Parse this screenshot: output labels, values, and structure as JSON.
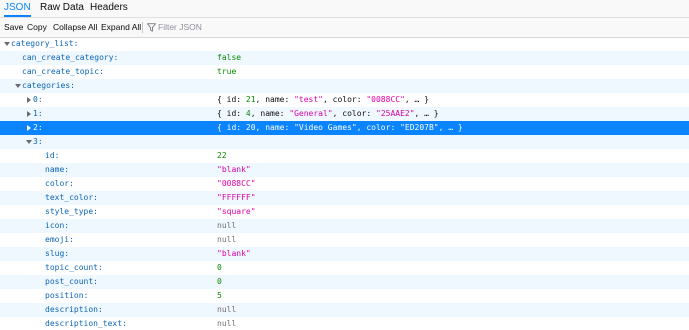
{
  "tabs": [
    {
      "label": "JSON",
      "selected": true
    },
    {
      "label": "Raw Data",
      "selected": false
    },
    {
      "label": "Headers",
      "selected": false
    }
  ],
  "toolbar": {
    "save_label": "Save",
    "copy_label": "Copy",
    "collapse_label": "Collapse All",
    "expand_label": "Expand All",
    "filter_placeholder": "Filter JSON",
    "filter_icon": "filter-icon"
  },
  "tree": {
    "root_key": "category_list:",
    "can_create_category": {
      "key": "can_create_category:",
      "value": "false"
    },
    "can_create_topic": {
      "key": "can_create_topic:",
      "value": "true"
    },
    "categories_key": "categories:",
    "cat0": {
      "key": "0:",
      "open": "{ ",
      "id_k": "id: ",
      "id_v": "21",
      "sep1": ", ",
      "name_k": "name: ",
      "name_v": "\"test\"",
      "sep2": ", ",
      "color_k": "color: ",
      "color_v": "\"0088CC\"",
      "tail": ", … }"
    },
    "cat1": {
      "key": "1:",
      "open": "{ ",
      "id_k": "id: ",
      "id_v": "4",
      "sep1": ", ",
      "name_k": "name: ",
      "name_v": "\"General\"",
      "sep2": ", ",
      "color_k": "color: ",
      "color_v": "\"25AAE2\"",
      "tail": ", … }"
    },
    "cat2": {
      "key": "2:",
      "open": "{ ",
      "id_k": "id: ",
      "id_v": "20",
      "sep1": ", ",
      "name_k": "name: ",
      "name_v": "\"Video Games\"",
      "sep2": ", ",
      "color_k": "color: ",
      "color_v": "\"ED207B\"",
      "tail": ", … }"
    },
    "cat3_key": "3:",
    "cat3_fields": [
      {
        "key": "id:",
        "value": "22",
        "type": "num"
      },
      {
        "key": "name:",
        "value": "\"blank\"",
        "type": "str"
      },
      {
        "key": "color:",
        "value": "\"0088CC\"",
        "type": "str"
      },
      {
        "key": "text_color:",
        "value": "\"FFFFFF\"",
        "type": "str"
      },
      {
        "key": "style_type:",
        "value": "\"square\"",
        "type": "str"
      },
      {
        "key": "icon:",
        "value": "null",
        "type": "null"
      },
      {
        "key": "emoji:",
        "value": "null",
        "type": "null"
      },
      {
        "key": "slug:",
        "value": "\"blank\"",
        "type": "str"
      },
      {
        "key": "topic_count:",
        "value": "0",
        "type": "num"
      },
      {
        "key": "post_count:",
        "value": "0",
        "type": "num"
      },
      {
        "key": "position:",
        "value": "5",
        "type": "num"
      },
      {
        "key": "description:",
        "value": "null",
        "type": "null"
      },
      {
        "key": "description_text:",
        "value": "null",
        "type": "null"
      }
    ]
  },
  "colors": {
    "accent": "#0a84ff",
    "key": "#0b64b6",
    "string": "#dd00a9",
    "number": "#058b00",
    "null": "#737373"
  }
}
